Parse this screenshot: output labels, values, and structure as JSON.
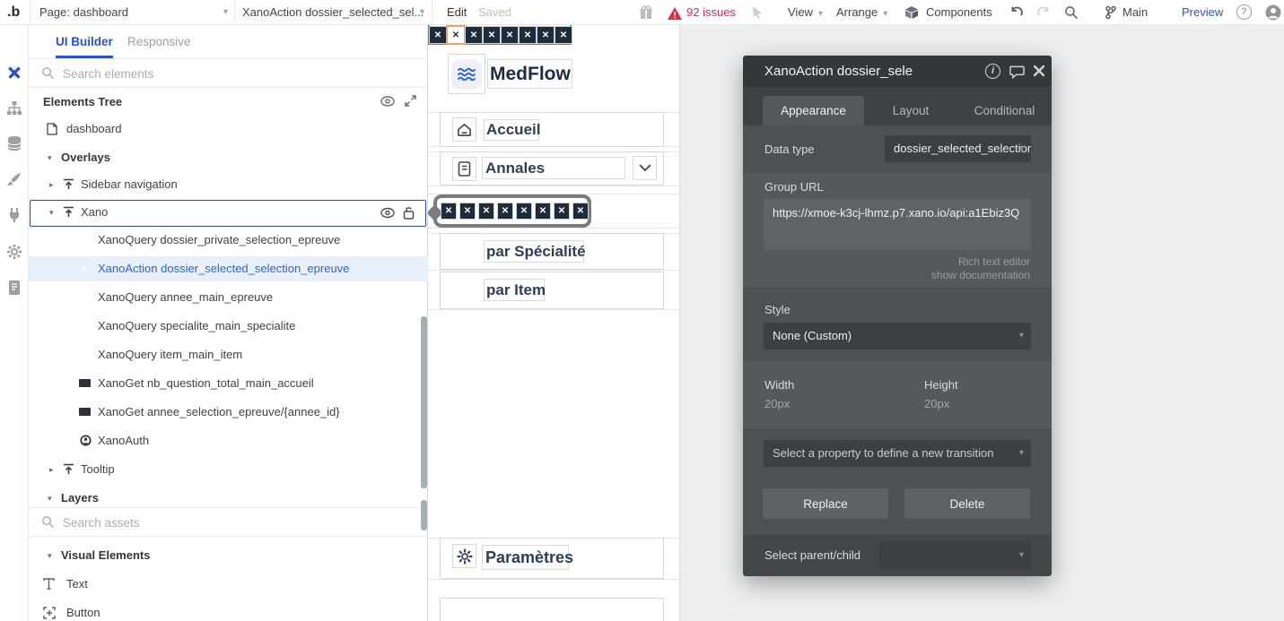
{
  "topbar": {
    "logo": ".b",
    "page_selector": "Page: dashboard",
    "element_selector": "XanoAction dossier_selected_sel...",
    "edit_label": "Edit",
    "saved_label": "Saved",
    "issues_label": "92 issues",
    "view_label": "View",
    "arrange_label": "Arrange",
    "components_label": "Components",
    "branch_label": "Main",
    "preview_label": "Preview"
  },
  "left_panel": {
    "tabs": [
      {
        "label": "UI Builder"
      },
      {
        "label": "Responsive"
      }
    ],
    "search_placeholder": "Search elements",
    "tree_header": "Elements Tree",
    "tree": [
      {
        "label": "dashboard"
      },
      {
        "label": "Overlays"
      },
      {
        "label": "Sidebar navigation"
      },
      {
        "label": "Xano"
      },
      {
        "label": "XanoQuery dossier_private_selection_epreuve"
      },
      {
        "label": "XanoAction dossier_selected_selection_epreuve"
      },
      {
        "label": "XanoQuery annee_main_epreuve"
      },
      {
        "label": "XanoQuery specialite_main_specialite"
      },
      {
        "label": "XanoQuery item_main_item"
      },
      {
        "label": "XanoGet nb_question_total_main_accueil"
      },
      {
        "label": "XanoGet annee_selection_epreuve/{annee_id}"
      },
      {
        "label": "XanoAuth"
      },
      {
        "label": "Tooltip"
      }
    ],
    "layers_header": "Layers",
    "assets_search_placeholder": "Search assets",
    "visual_elements_header": "Visual Elements",
    "visual_elements": [
      {
        "label": "Text"
      },
      {
        "label": "Button"
      }
    ]
  },
  "canvas": {
    "brand": "MedFlow",
    "nav_home": "Accueil",
    "nav_annales": "Annales",
    "nav_by_specialty": "par Spécialité",
    "nav_by_item": "par Item",
    "nav_settings": "Paramètres"
  },
  "inspector": {
    "title": "XanoAction dossier_sele",
    "tab_appearance": "Appearance",
    "tab_layout": "Layout",
    "tab_conditional": "Conditional",
    "data_type_label": "Data type",
    "data_type_value": "dossier_selected_selection_e",
    "group_url_label": "Group URL",
    "group_url_value": "https://xmoe-k3cj-lhmz.p7.xano.io/api:a1Ebiz3Q",
    "link_rich_text": "Rich text editor",
    "link_docs": "show documentation",
    "style_label": "Style",
    "style_value": "None (Custom)",
    "width_label": "Width",
    "width_value": "20px",
    "height_label": "Height",
    "height_value": "20px",
    "transition_placeholder": "Select a property to define a new transition",
    "replace_label": "Replace",
    "delete_label": "Delete",
    "parent_child_label": "Select parent/child"
  },
  "colors": {
    "accent_blue": "#2753d9",
    "issues_red": "#e02a47",
    "brand_blue": "#2563eb",
    "selection_teal": "#0ba7c4",
    "tree_highlight": "#e8f1fb",
    "inspector_dark": "#34383b"
  }
}
